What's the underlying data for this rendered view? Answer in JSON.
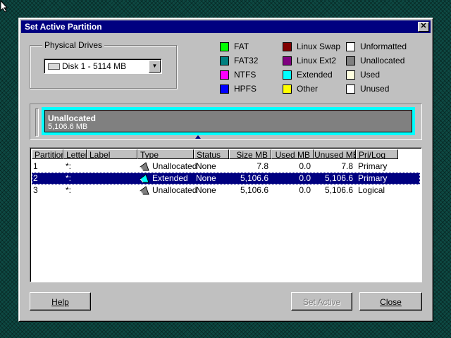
{
  "dialog": {
    "title": "Set Active Partition"
  },
  "physical_drives": {
    "label": "Physical Drives",
    "selected": "Disk 1 - 5114  MB"
  },
  "legend": [
    {
      "label": "FAT",
      "color": "#00ff00"
    },
    {
      "label": "FAT32",
      "color": "#008080"
    },
    {
      "label": "NTFS",
      "color": "#ff00ff"
    },
    {
      "label": "HPFS",
      "color": "#0000ff"
    },
    {
      "label": "Linux Swap",
      "color": "#800000"
    },
    {
      "label": "Linux Ext2",
      "color": "#800080"
    },
    {
      "label": "Extended",
      "color": "#00ffff"
    },
    {
      "label": "Other",
      "color": "#ffff00"
    },
    {
      "label": "Unformatted",
      "color": "#ffffff"
    },
    {
      "label": "Unallocated",
      "color": "#808080"
    },
    {
      "label": "Used",
      "color": "#ffffe0"
    },
    {
      "label": "Unused",
      "color": "#ffffff"
    }
  ],
  "disk_map": {
    "segment_type": "Unallocated",
    "segment_size": "5,106.6 MB",
    "segment_color": "#808080",
    "container_color": "#00ffff"
  },
  "table": {
    "columns": [
      "Partition",
      "Letter",
      "Label",
      "Type",
      "Status",
      "Size MB",
      "Used MB",
      "Unused MB",
      "Pri/Log"
    ],
    "rows": [
      {
        "partition": "1",
        "letter": "*:",
        "label": "",
        "type": "Unallocated",
        "status": "None",
        "size": "7.8",
        "used": "0.0",
        "unused": "7.8",
        "prilog": "Primary",
        "icon": "unallocated-partition-icon"
      },
      {
        "partition": "2",
        "letter": "*:",
        "label": "",
        "type": "Extended",
        "status": "None",
        "size": "5,106.6",
        "used": "0.0",
        "unused": "5,106.6",
        "prilog": "Primary",
        "icon": "extended-partition-icon"
      },
      {
        "partition": "3",
        "letter": "*:",
        "label": "",
        "type": "Unallocated",
        "status": "None",
        "size": "5,106.6",
        "used": "0.0",
        "unused": "5,106.6",
        "prilog": "Logical",
        "icon": "unallocated-partition-icon"
      }
    ],
    "selected_row": 1
  },
  "buttons": {
    "help": "Help",
    "set_active": "Set Active",
    "close": "Close"
  }
}
